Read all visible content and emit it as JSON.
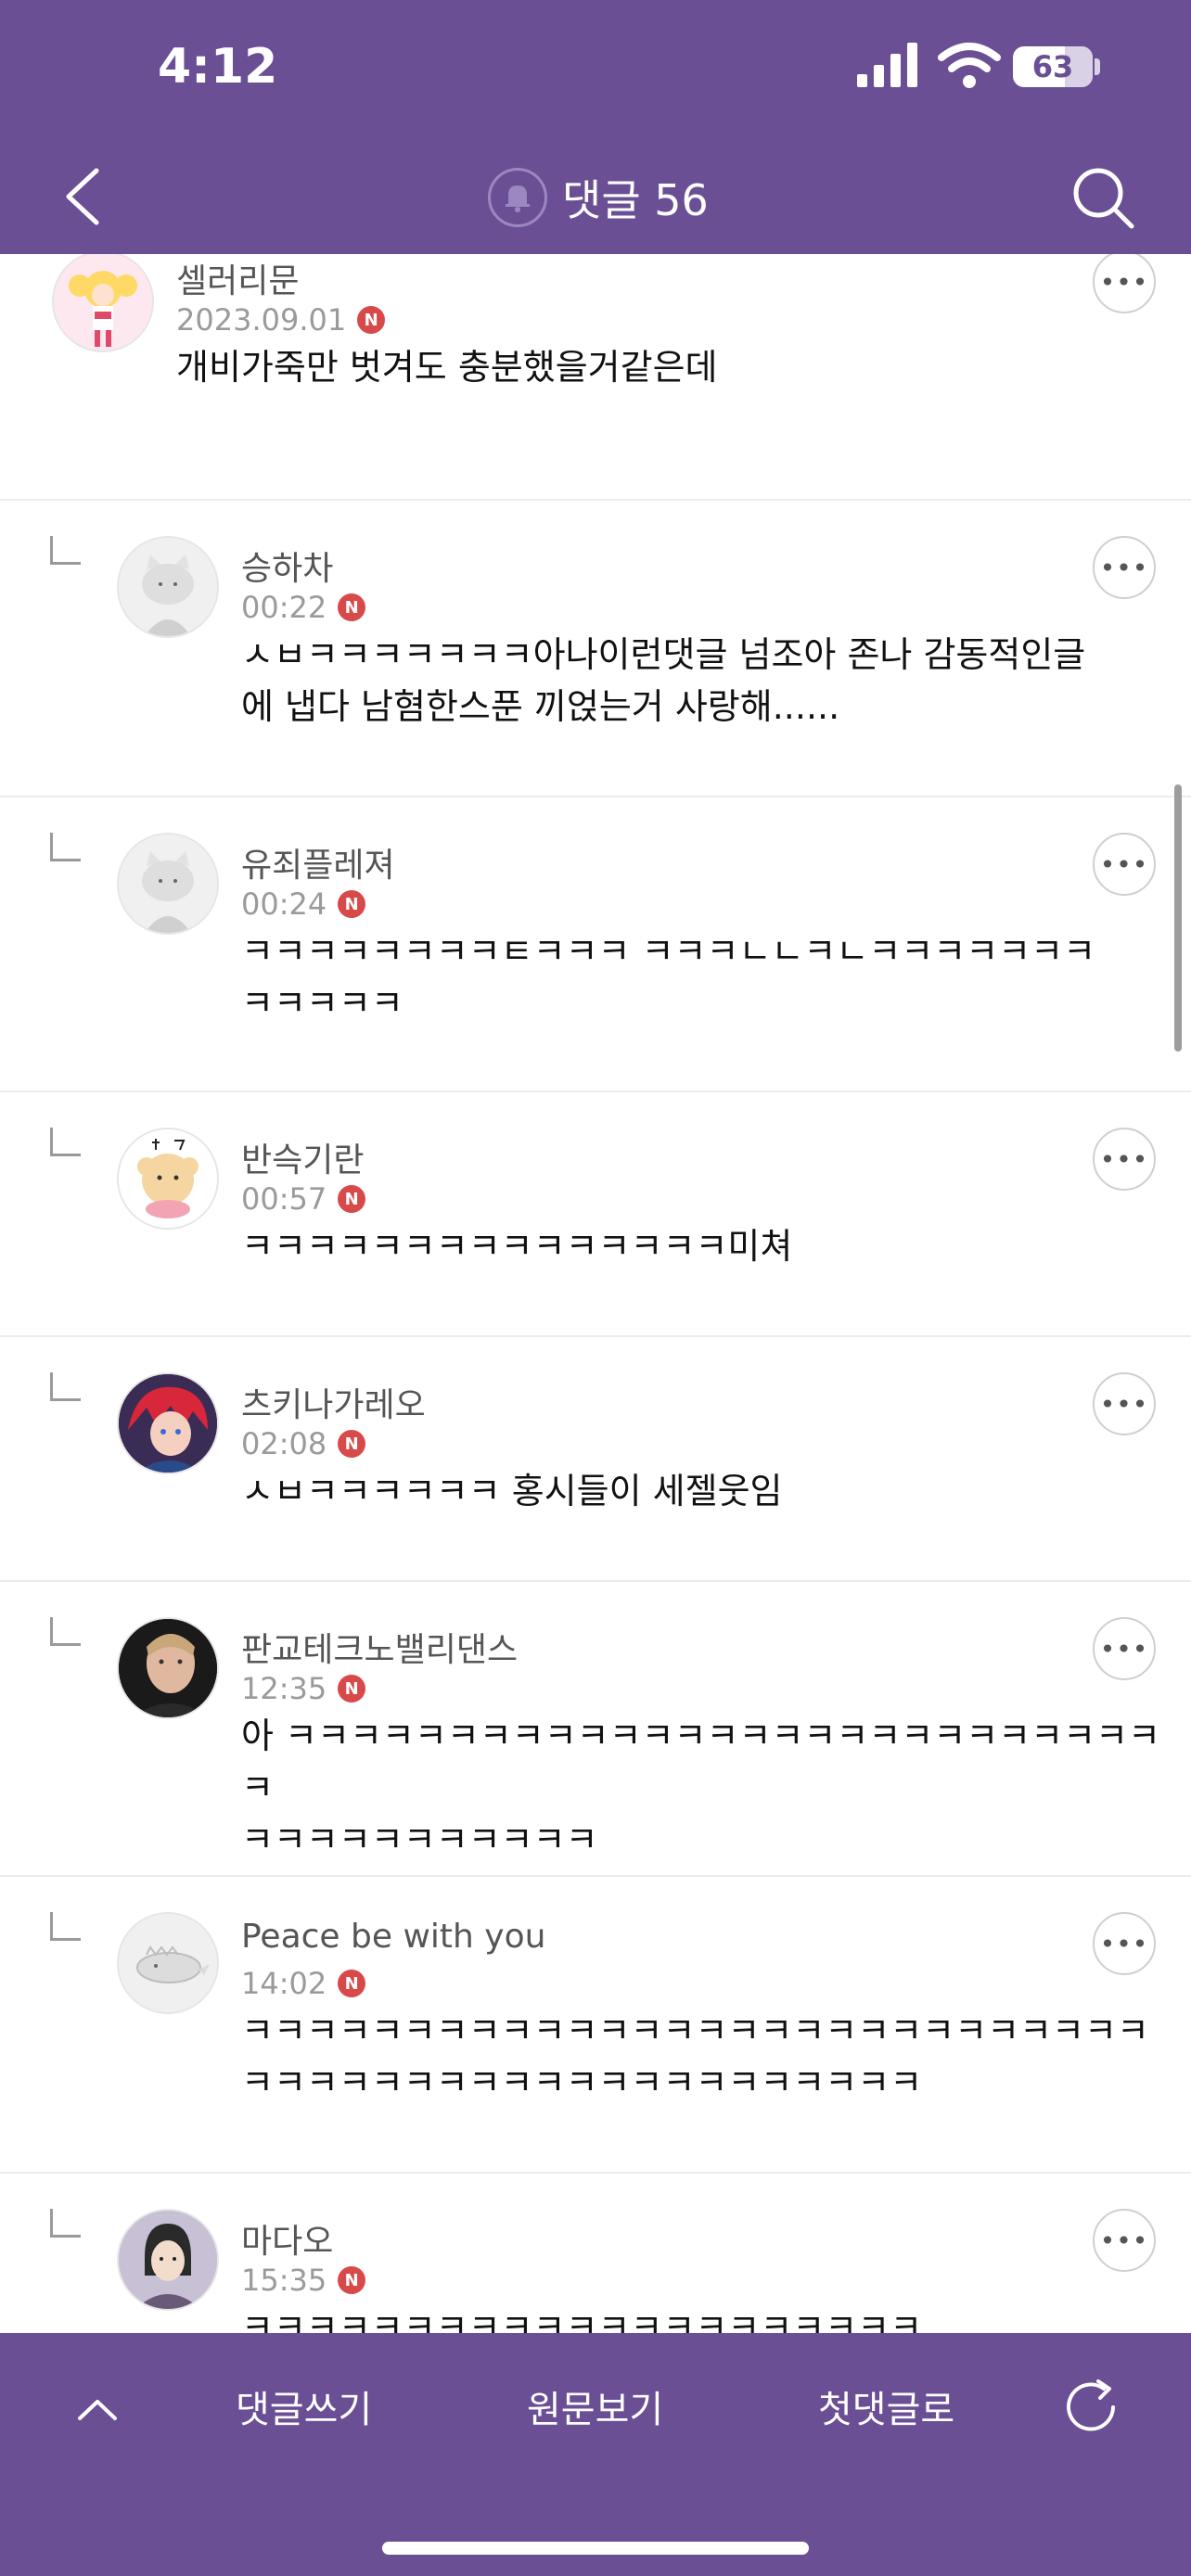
{
  "status": {
    "time": "4:12",
    "battery": "63"
  },
  "header": {
    "title": "댓글 56"
  },
  "comments": [
    {
      "nick": "셀러리문",
      "date": "2023.09.01",
      "badge": "N",
      "lines": [
        "개비가죽만 벗겨도 충분했을거같은데",
        ""
      ],
      "reply": false,
      "avatar": "sailor-moon"
    },
    {
      "nick": "승하차",
      "date": "00:22",
      "badge": "N",
      "lines": [
        "ㅅㅂㅋㅋㅋㅋㅋㅋㅋ아나이런댓글 넘조아 존나 감동적인글",
        "에 냅다 남혐한스푼 끼얹는거 사랑해......"
      ],
      "reply": true,
      "avatar": "cat"
    },
    {
      "nick": "유죄플레져",
      "date": "00:24",
      "badge": "N",
      "lines": [
        "ㅋㅋㅋㅋㅋㅋㅋㅋㅌㅋㅋㅋ ㅋㅋㅋㄴㄴㅋㄴㅋㅋㅋㅋㅋㅋㅋ",
        "ㅋㅋㅋㅋㅋ"
      ],
      "reply": true,
      "avatar": "cat"
    },
    {
      "nick": "반슥기란",
      "date": "00:57",
      "badge": "N",
      "lines": [
        "ㅋㅋㅋㅋㅋㅋㅋㅋㅋㅋㅋㅋㅋㅋㅋ미쳐",
        ""
      ],
      "reply": true,
      "avatar": "bear"
    },
    {
      "nick": "츠키나가레오",
      "date": "02:08",
      "badge": "N",
      "lines": [
        "ㅅㅂㅋㅋㅋㅋㅋㅋ 홍시들이 세젤웃임",
        ""
      ],
      "reply": true,
      "avatar": "anime-red"
    },
    {
      "nick": "판교테크노밸리댄스",
      "date": "12:35",
      "badge": "N",
      "lines": [
        "아 ㅋㅋㅋㅋㅋㅋㅋㅋㅋㅋㅋㅋㅋㅋㅋㅋㅋㅋㅋㅋㅋㅋㅋㅋㅋㅋㅋㅋ",
        "ㅋㅋㅋㅋㅋㅋㅋㅋㅋㅋㅋ"
      ],
      "reply": true,
      "avatar": "photo"
    },
    {
      "nick": "Peace be with you",
      "date": "14:02",
      "badge": "N",
      "lines": [
        "ㅋㅋㅋㅋㅋㅋㅋㅋㅋㅋㅋㅋㅋㅋㅋㅋㅋㅋㅋㅋㅋㅋㅋㅋㅋㅋㅋㅋ",
        "ㅋㅋㅋㅋㅋㅋㅋㅋㅋㅋㅋㅋㅋㅋㅋㅋㅋㅋㅋㅋㅋ"
      ],
      "reply": true,
      "avatar": "dino"
    },
    {
      "nick": "마다오",
      "date": "15:35",
      "badge": "N",
      "lines": [
        "ㅋㅋㅋㅋㅋㅋㅋㅋㅋㅋㅋㅋㅋㅋㅋㅋㅋㅋㅋㅋㅋ",
        ""
      ],
      "reply": true,
      "avatar": "anime-dark"
    }
  ],
  "bottom": {
    "write": "댓글쓰기",
    "original": "원문보기",
    "first": "첫댓글로"
  },
  "icons": {
    "back": "chevron-left-icon",
    "bell": "bell-icon",
    "search": "search-icon",
    "up": "chevron-up-icon",
    "refresh": "refresh-icon",
    "more": "more-dots-icon"
  },
  "colors": {
    "brand": "#6a4f95",
    "badge": "#d84a4a"
  }
}
